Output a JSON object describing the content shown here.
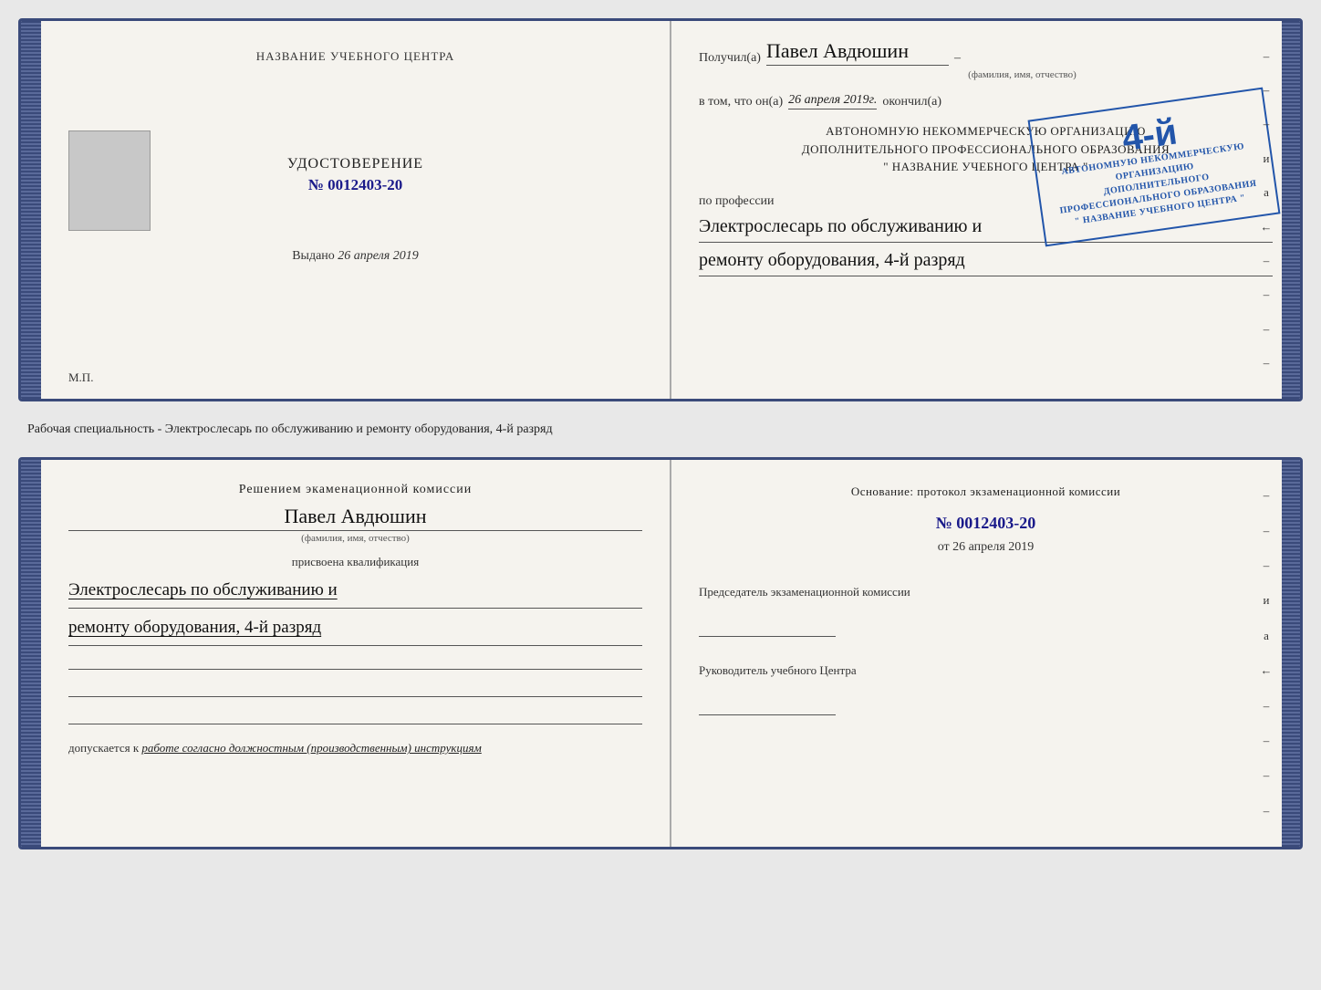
{
  "top_doc": {
    "left": {
      "title": "НАЗВАНИЕ УЧЕБНОГО ЦЕНТРА",
      "doc_type": "УДОСТОВЕРЕНИЕ",
      "doc_number_prefix": "№",
      "doc_number": "0012403-20",
      "vydano_label": "Выдано",
      "vydano_date": "26 апреля 2019",
      "mp_label": "М.П."
    },
    "right": {
      "poluchil_label": "Получил(а)",
      "recipient_name": "Павел Авдюшин",
      "fio_hint": "(фамилия, имя, отчество)",
      "vtom_label": "в том, что он(а)",
      "vtom_date": "26 апреля 2019г.",
      "okончил_label": "окончил(а)",
      "stamp_grade": "4-й",
      "stamp_line1": "АВТОНОМНУЮ НЕКОММЕРЧЕСКУЮ ОРГАНИЗАЦИЮ",
      "stamp_line2": "ДОПОЛНИТЕЛЬНОГО ПРОФЕССИОНАЛЬНОГО ОБРАЗОВАНИЯ",
      "stamp_line3": "\" НАЗВАНИЕ УЧЕБНОГО ЦЕНТРА \"",
      "po_professii": "по профессии",
      "profession_line1": "Электрослесарь по обслуживанию и",
      "profession_line2": "ремонту оборудования, 4-й разряд"
    }
  },
  "middle": {
    "text": "Рабочая специальность - Электрослесарь по обслуживанию и ремонту оборудования, 4-й разряд"
  },
  "bottom_doc": {
    "left": {
      "reshenie_text": "Решением экаменационной комиссии",
      "name": "Павел Авдюшин",
      "fio_hint": "(фамилия, имя, отчество)",
      "prisvoyena": "присвоена квалификация",
      "qual_line1": "Электрослесарь по обслуживанию и",
      "qual_line2": "ремонту оборудования, 4-й разряд",
      "dopuskaetsya_prefix": "допускается к",
      "dopuskaetsya_italic": "работе согласно должностным (производственным) инструкциям"
    },
    "right": {
      "osnovanie_text": "Основание: протокол экзаменационной комиссии",
      "protocol_prefix": "№",
      "protocol_number": "0012403-20",
      "ot_prefix": "от",
      "ot_date": "26 апреля 2019",
      "predsedatel_title": "Председатель экзаменационной комиссии",
      "rukovoditel_title": "Руководитель учебного Центра"
    }
  },
  "right_side_chars": [
    "-",
    "-",
    "-",
    "и",
    "а",
    "←",
    "-",
    "-",
    "-",
    "-"
  ],
  "right_side_chars_bottom": [
    "-",
    "-",
    "-",
    "и",
    "а",
    "←",
    "-",
    "-",
    "-",
    "-"
  ]
}
